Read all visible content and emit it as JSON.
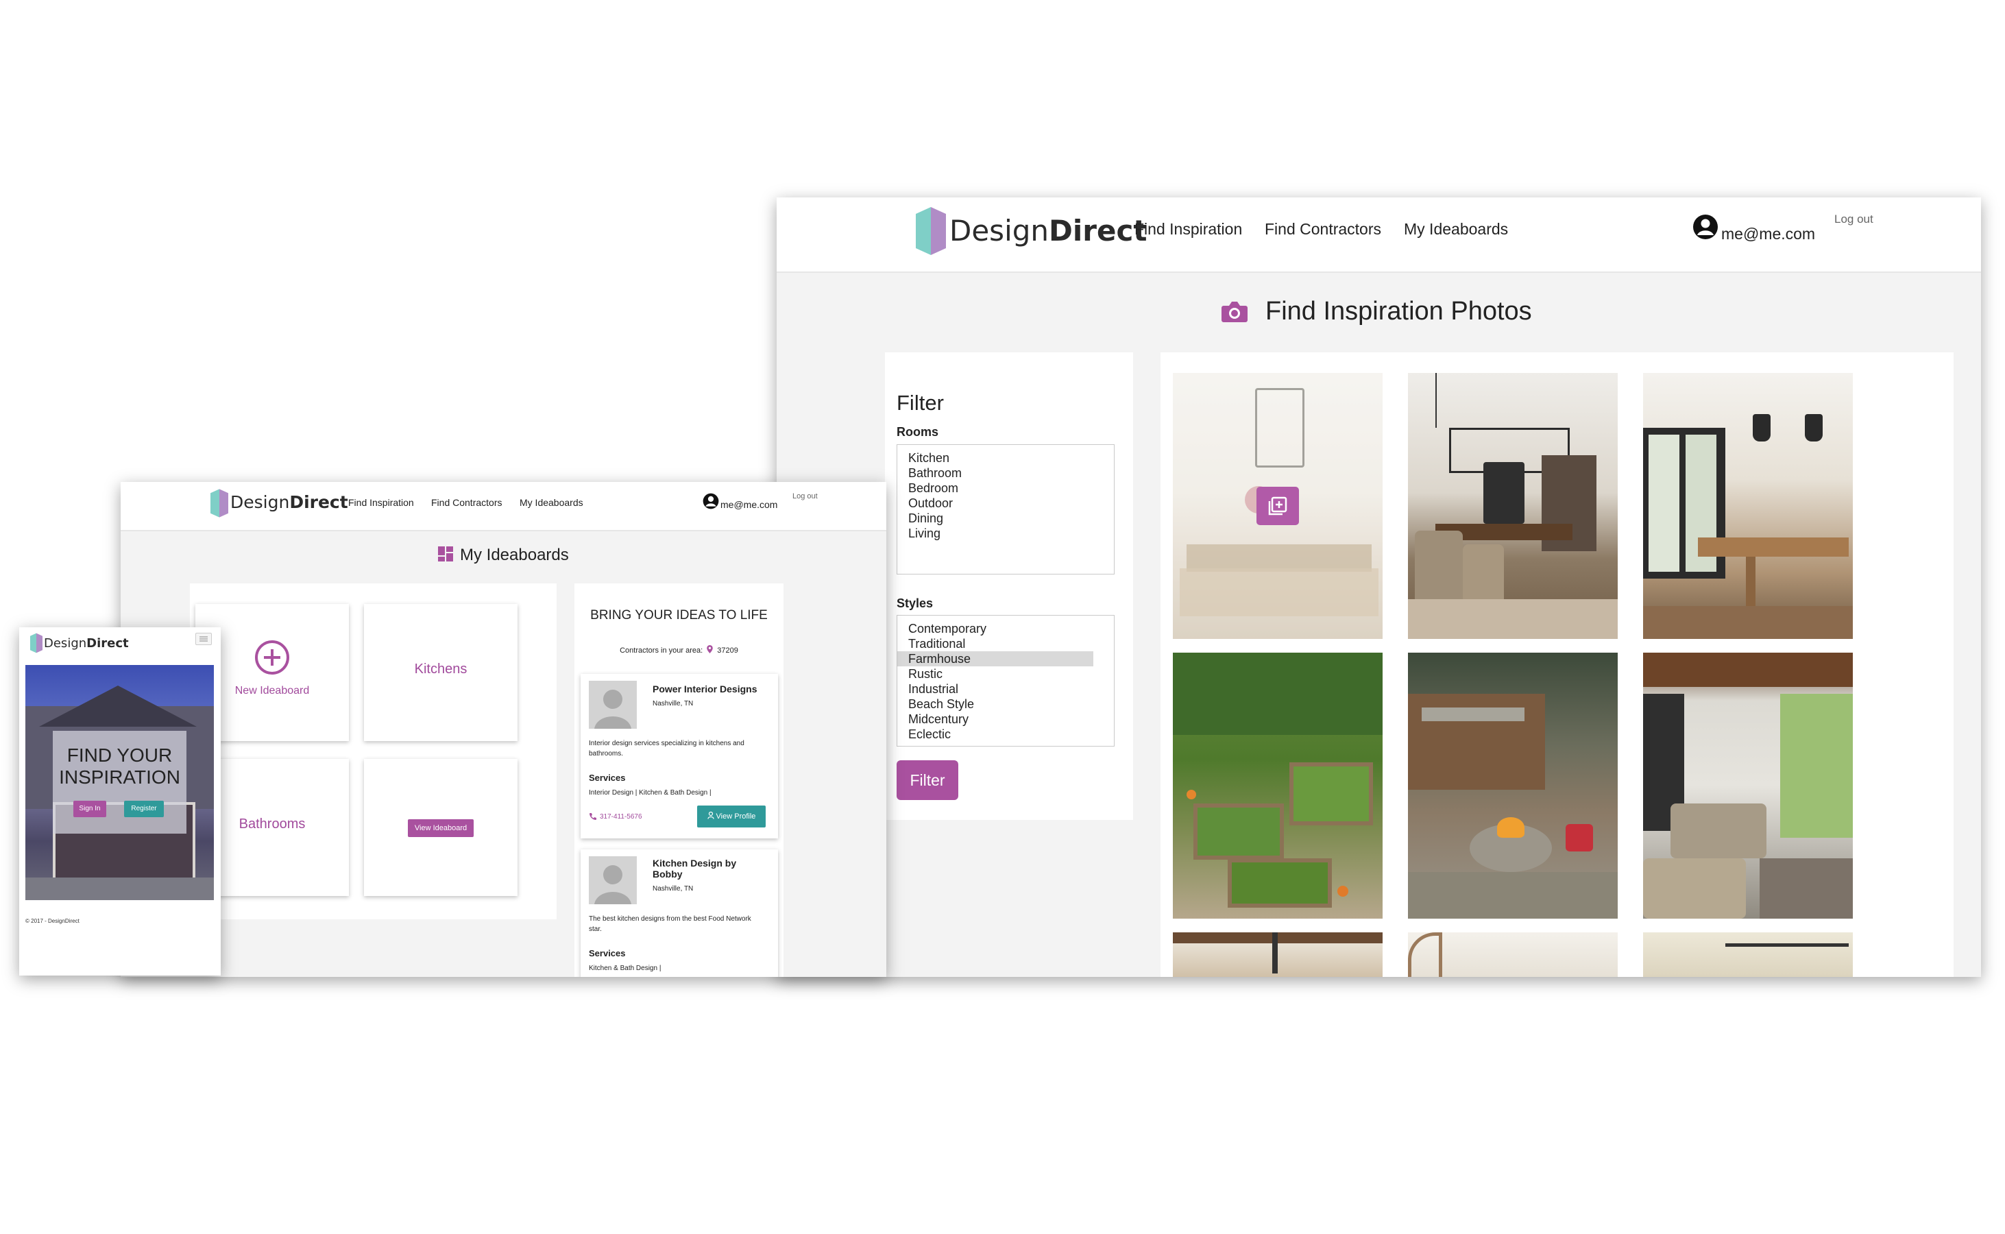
{
  "brand": {
    "name_light": "Design",
    "name_bold": "Direct"
  },
  "colors": {
    "accent": "#a9519f",
    "teal": "#2f9a9a",
    "logo_teal": "#7fcfc7",
    "logo_purple": "#a77fc0"
  },
  "inspiration_page": {
    "nav": {
      "links": [
        "Find Inspiration",
        "Find Contractors",
        "My Ideaboards"
      ],
      "user_email": "me@me.com",
      "logout": "Log out",
      "user_icon": "user-circle-icon"
    },
    "page_title": "Find Inspiration Photos",
    "title_icon": "camera-icon",
    "filter": {
      "heading": "Filter",
      "rooms_label": "Rooms",
      "rooms": [
        "Kitchen",
        "Bathroom",
        "Bedroom",
        "Outdoor",
        "Dining",
        "Living"
      ],
      "styles_label": "Styles",
      "styles": [
        "Contemporary",
        "Traditional",
        "Farmhouse",
        "Rustic",
        "Industrial",
        "Beach Style",
        "Midcentury",
        "Eclectic"
      ],
      "selected_style": "Farmhouse",
      "button": "Filter"
    },
    "photos": [
      "dining-room-photo",
      "dining-room-photo",
      "dining-room-photo",
      "garden-photo",
      "patio-firepit-photo",
      "porch-photo",
      "ceiling-photo",
      "window-photo",
      "room-photo"
    ],
    "add_icon": "add-to-ideaboard-icon"
  },
  "ideaboards_page": {
    "nav": {
      "links": [
        "Find Inspiration",
        "Find Contractors",
        "My Ideaboards"
      ],
      "user_email": "me@me.com",
      "logout": "Log out"
    },
    "page_title": "My Ideaboards",
    "title_icon": "dashboard-icon",
    "boards": {
      "new": "New Ideaboard",
      "kitchens": "Kitchens",
      "bathrooms": "Bathrooms",
      "view": "View Ideaboard"
    },
    "side": {
      "heading": "BRING YOUR IDEAS TO LIFE",
      "contractors_label": "Contractors in your area:",
      "zip": "37209",
      "contractors": [
        {
          "name": "Power Interior Designs",
          "location": "Nashville, TN",
          "description": "Interior design services specializing in kitchens and bathrooms.",
          "services_label": "Services",
          "services": "Interior Design | Kitchen & Bath Design |",
          "phone": "317-411-5676",
          "profile_button": "View Profile"
        },
        {
          "name": "Kitchen Design by Bobby",
          "location": "Nashville, TN",
          "description": "The best kitchen designs from the best Food Network star.",
          "services_label": "Services",
          "services": "Kitchen & Bath Design |"
        }
      ]
    }
  },
  "mobile_page": {
    "hero_title": "FIND YOUR INSPIRATION",
    "sign_in": "Sign In",
    "register": "Register",
    "footer": "© 2017 - DesignDirect",
    "menu_icon": "hamburger-menu-icon"
  }
}
